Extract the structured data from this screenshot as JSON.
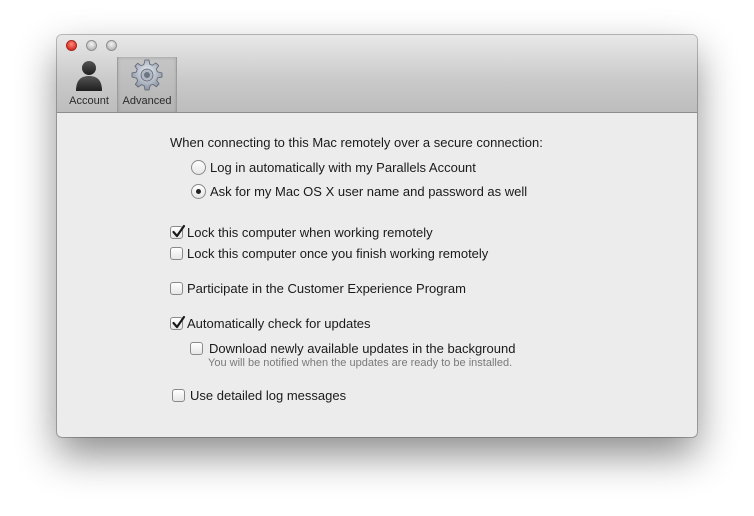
{
  "toolbar": {
    "tabs": [
      {
        "label": "Account",
        "icon": "user-silhouette-icon"
      },
      {
        "label": "Advanced",
        "icon": "gear-icon",
        "selected": true
      }
    ]
  },
  "content": {
    "intro": "When connecting to this Mac remotely over a secure connection:",
    "radio_login_auto": "Log in automatically with my Parallels Account",
    "radio_ask_credentials": "Ask for my Mac OS X user name and password as well",
    "lock_when_working": "Lock this computer when working remotely",
    "lock_after_finish": "Lock this computer once you finish working remotely",
    "participate_cep": "Participate in the Customer Experience Program",
    "auto_check_updates": "Automatically check for updates",
    "download_background": "Download newly available updates in the background",
    "download_hint": "You will be notified when the updates are ready to be installed.",
    "detailed_log": "Use detailed log messages"
  },
  "state": {
    "radio_selected": "ask_credentials",
    "lock_when_working": true,
    "lock_after_finish": false,
    "participate_cep": false,
    "auto_check_updates": true,
    "download_background": false,
    "detailed_log": false
  },
  "colors": {
    "close_button": "#d8322a",
    "window_background": "#ececec"
  }
}
